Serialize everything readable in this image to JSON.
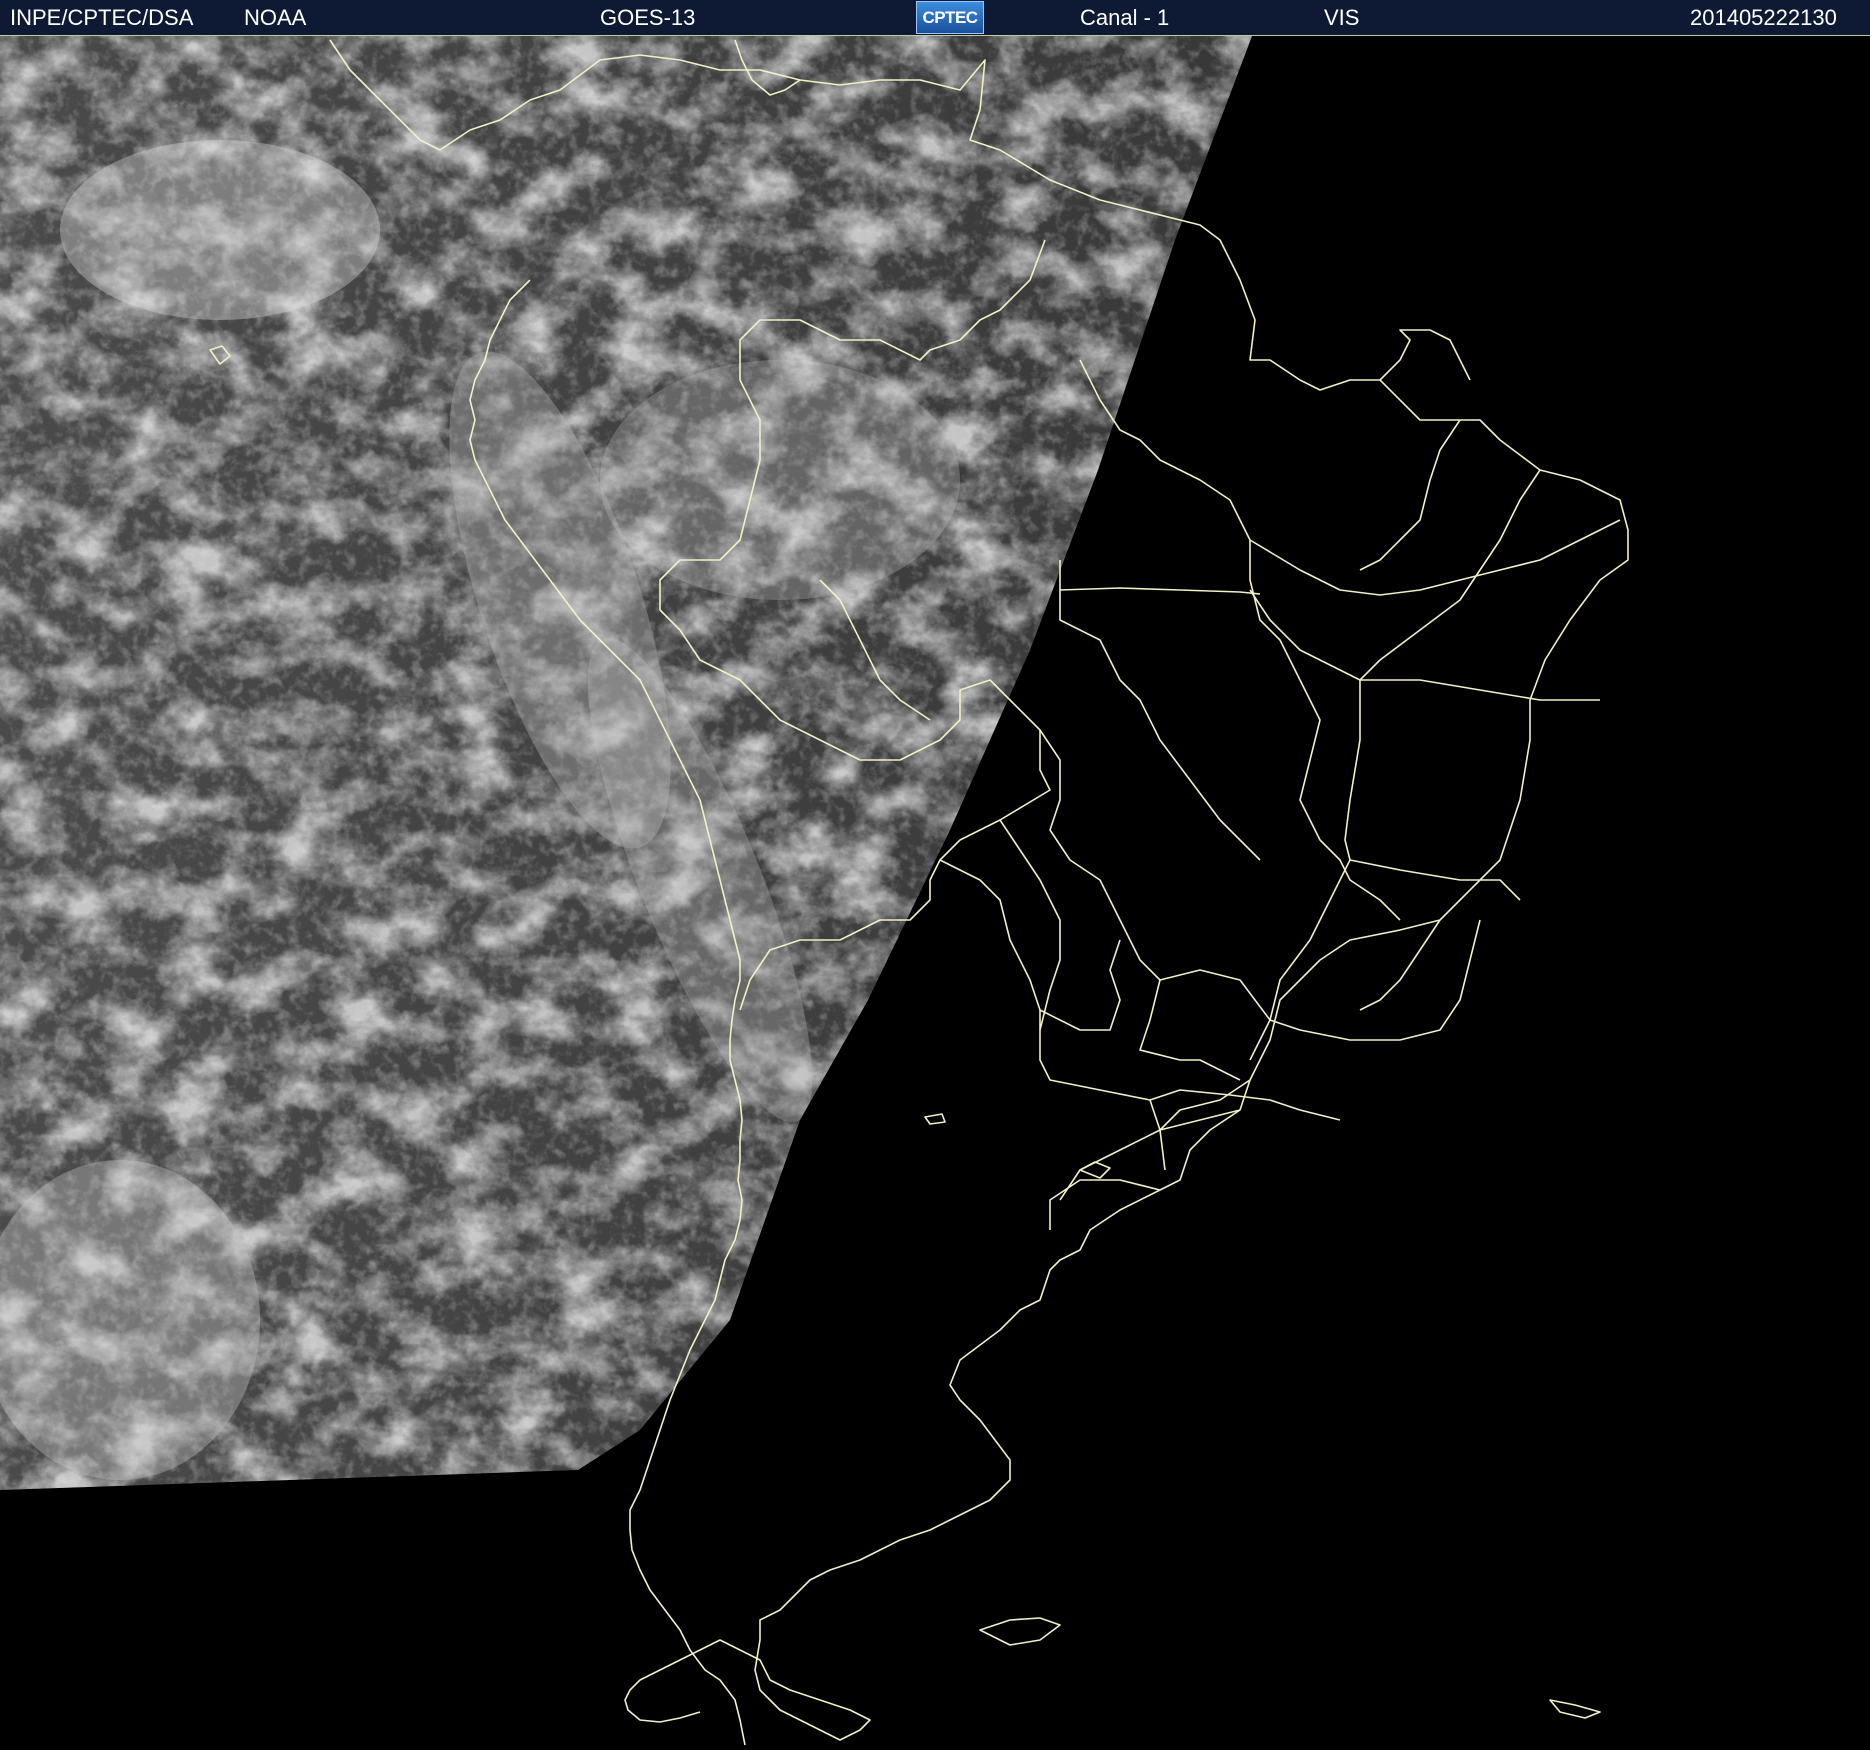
{
  "header": {
    "organization": "INPE/CPTEC/DSA",
    "agency": "NOAA",
    "satellite": "GOES-13",
    "logo_text": "CPTEC",
    "channel": "Canal - 1",
    "band": "VIS",
    "timestamp": "201405222130"
  },
  "map": {
    "coastline_color": "#f2f0c4",
    "night_color": "#000000",
    "cloud_color": "#d8d8d8"
  }
}
